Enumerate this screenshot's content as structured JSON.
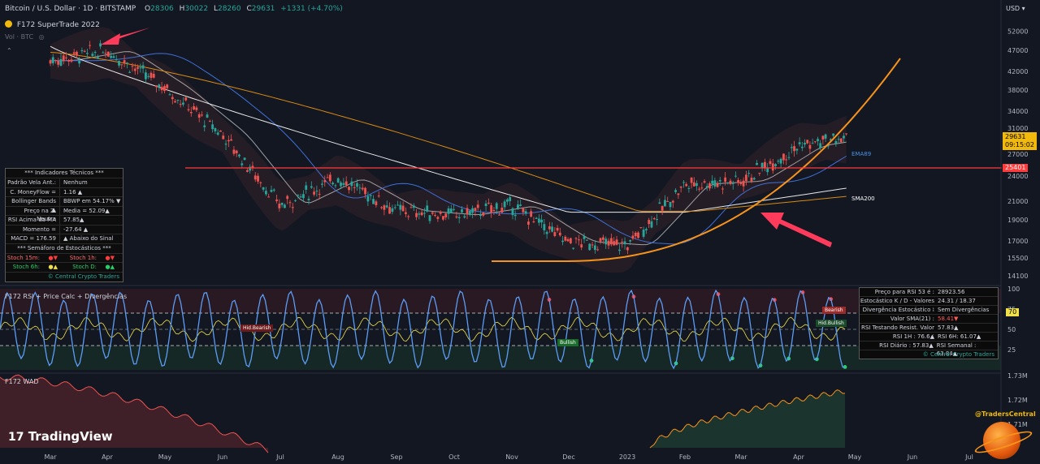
{
  "header": {
    "symbol": "Bitcoin / U.S. Dollar · 1D · BITSTAMP",
    "o_label": "O",
    "o_value": "28306",
    "h_label": "H",
    "h_value": "30022",
    "l_label": "L",
    "l_value": "28260",
    "c_label": "C",
    "c_value": "29631",
    "change": "+1331 (+4.70%)",
    "indicator_name": "F172 SuperTrade 2022",
    "vol_label": "Vol · BTC",
    "currency": "USD"
  },
  "colors": {
    "background": "#131722",
    "bull": "#26a69a",
    "bear": "#ef5350",
    "support_line": "#ff3b3b",
    "curve": "#f7931a",
    "rsi_line": "#5b9cf6",
    "annotation_arrow": "#ff3b5c"
  },
  "price_axis": {
    "ticks": [
      "52000",
      "47000",
      "42000",
      "38000",
      "34000",
      "31000",
      "27000",
      "24000",
      "21000",
      "19000",
      "17000",
      "15500",
      "14100"
    ],
    "current_price": "29631",
    "countdown": "09:15:02",
    "support_price": "25401"
  },
  "ma_labels": {
    "ema89": "EMA89",
    "sma200": "SMA200"
  },
  "time_axis": [
    "Mar",
    "Apr",
    "May",
    "Jun",
    "Jul",
    "Aug",
    "Sep",
    "Oct",
    "Nov",
    "Dec",
    "2023",
    "Feb",
    "Mar",
    "Apr",
    "May",
    "Jun",
    "Jul"
  ],
  "info_table": {
    "title": "*** Indicadores Técnicos ***",
    "rows": [
      {
        "label": "Padrão Vela Ant.:",
        "value": "Nenhum"
      },
      {
        "label": "C. MoneyFlow =",
        "value": "1.16 ▲"
      },
      {
        "label": "Bollinger Bands ▲",
        "value": "BBWP em 54.17% ▼"
      },
      {
        "label": "Preço na Z. Neutra",
        "value": "Media = 52.09▲"
      },
      {
        "label": "RSI Acima da MA",
        "value": "57.85▲"
      },
      {
        "label": "Momento =",
        "value": "-27.64 ▲"
      },
      {
        "label": "MACD = 176.59",
        "value": "▲ Abaixo do Sinal"
      }
    ],
    "semaforo_title": "*** Semáforo de     Estocásticos ***",
    "stoch": [
      {
        "label": "Stoch 15m:",
        "dots": "●▼",
        "label2": "Stoch 1h:",
        "dots2": "●▼"
      },
      {
        "label": "Stoch 6h:",
        "dots": "●▲",
        "label2": "Stoch D:",
        "dots2": "●▲"
      }
    ],
    "footer": "© Central Crypto Traders"
  },
  "rsi_panel": {
    "title": "F172 RSI + Price Calc + Divergências",
    "ticks": [
      "100",
      "75",
      "50",
      "25"
    ],
    "level_70": "70",
    "labels": {
      "hid_bearish": "Hid.Bearish",
      "bullish": "Bullish",
      "bearish": "Bearish",
      "hid_bullish": "Hid.Bullish"
    },
    "table": [
      {
        "label": "Preço para RSI 53 é :",
        "value": "28923.56"
      },
      {
        "label": "Estocástico K / D - Valores :",
        "value": "24.31 / 18.37"
      },
      {
        "label": "Divergência Estocástico :",
        "value": "Sem Divergências"
      },
      {
        "label": "Valor SMA(21) :",
        "value": "58.41▼"
      },
      {
        "label": "RSI  Testando Resist. Valor :",
        "value": "57.83▲"
      },
      {
        "label": "RSI 1H : 76.6▲",
        "value": "RSI 6H: 61.07▲"
      },
      {
        "label": "RSI Diário : 57.83▲",
        "value": "RSI Semanal : 63.84▲"
      }
    ],
    "footer": "© Central Crypto Traders"
  },
  "wad_panel": {
    "title": "F172 WAD",
    "ticks": [
      "1.73M",
      "1.72M",
      "1.71M"
    ]
  },
  "watermark": {
    "brand": "TradingView",
    "handle": "@TradersCentral"
  },
  "chart_data": {
    "type": "candlestick",
    "title": "Bitcoin / U.S. Dollar · 1D · BITSTAMP",
    "xlabel": "",
    "ylabel": "",
    "ylim": [
      13500,
      54000
    ],
    "y_scale": "log",
    "months": [
      "Mar",
      "Apr",
      "May",
      "Jun",
      "Jul",
      "Aug",
      "Sep",
      "Oct",
      "Nov",
      "Dec",
      "2023",
      "Feb",
      "Mar",
      "Apr",
      "May",
      "Jun",
      "Jul"
    ],
    "price_path": [
      {
        "x": "Mar",
        "y": 44500
      },
      {
        "x": "Apr",
        "y": 47000
      },
      {
        "x": "May",
        "y": 38500
      },
      {
        "x": "Jun",
        "y": 30000
      },
      {
        "x": "Jul",
        "y": 20500
      },
      {
        "x": "Aug",
        "y": 23800
      },
      {
        "x": "Sep",
        "y": 20000
      },
      {
        "x": "Oct",
        "y": 19500
      },
      {
        "x": "Nov",
        "y": 20500
      },
      {
        "x": "Dec",
        "y": 16900
      },
      {
        "x": "2023",
        "y": 16600
      },
      {
        "x": "Feb",
        "y": 23000
      },
      {
        "x": "Mar",
        "y": 23400
      },
      {
        "x": "Apr",
        "y": 28200
      },
      {
        "x": "May",
        "y": 29631
      }
    ],
    "support_level": 25401,
    "last_close": 29631,
    "ohlc_last": {
      "open": 28306,
      "high": 30022,
      "low": 28260,
      "close": 29631
    },
    "ma_series": [
      "EMA89",
      "SMA200"
    ],
    "grid": false,
    "legend": "none"
  }
}
